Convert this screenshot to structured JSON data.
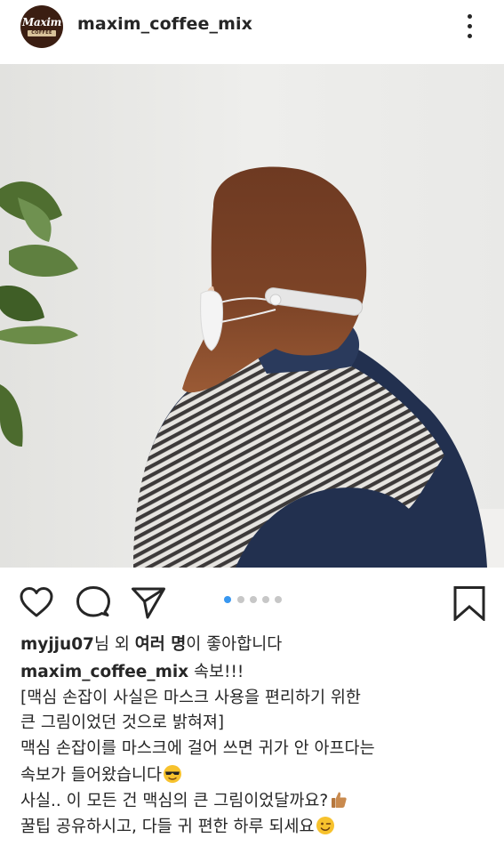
{
  "header": {
    "username": "maxim_coffee_mix",
    "avatar_logo_text": "Maxim",
    "avatar_logo_sub": "COFFEE MIX",
    "more_icon": "more-vertical-icon"
  },
  "post": {
    "image_alt_icons": [
      "plant-leaves",
      "person-with-mask-holder"
    ],
    "carousel": {
      "count": 5,
      "active_index": 0
    },
    "actions": {
      "like_icon": "heart-icon",
      "comment_icon": "comment-icon",
      "share_icon": "send-icon",
      "save_icon": "bookmark-icon"
    }
  },
  "likes": {
    "user": "myjju07",
    "mid_text": "님 외 ",
    "others": "여러 명",
    "suffix": "이 좋아합니다"
  },
  "caption": {
    "author": "maxim_coffee_mix",
    "first_line_text": " 속보!!!",
    "lines": [
      "[맥심 손잡이 사실은 마스크 사용을 편리하기 위한",
      "큰 그림이었던 것으로 밝혀져]",
      "맥심 손잡이를 마스크에 걸어 쓰면 귀가 안 아프다는",
      "속보가 들어왔습니다",
      "사실.. 이 모든 건 맥심의 큰 그림이었달까요?",
      "꿀팁 공유하시고, 다들 귀 편한 하루 되세요"
    ],
    "emojis": [
      "sunglasses-emoji",
      "thumbs-up-emoji",
      "wink-emoji"
    ]
  },
  "colors": {
    "text": "#262626",
    "carousel_active": "#3897f0",
    "carousel_inactive": "#c7c7c7",
    "brand_brown": "#3b1e12"
  }
}
